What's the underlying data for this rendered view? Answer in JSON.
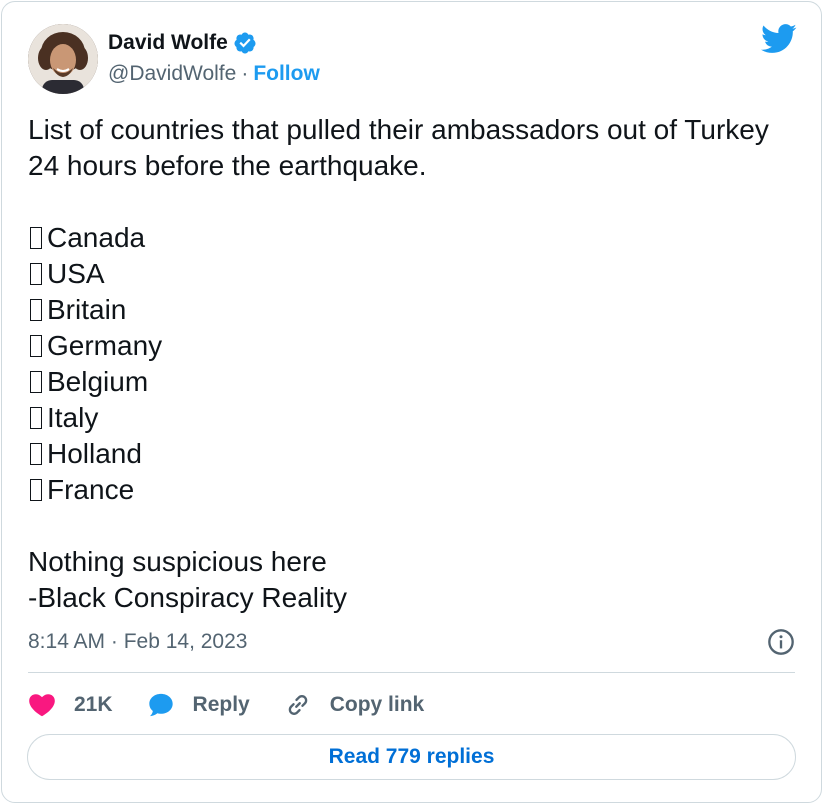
{
  "author": {
    "name": "David Wolfe",
    "handle": "@DavidWolfe",
    "separator": "·",
    "follow_label": "Follow"
  },
  "tweet": {
    "intro": "List of countries that pulled their ambassadors out of Turkey 24 hours before the earthquake.",
    "countries": [
      "Canada",
      "USA",
      "Britain",
      "Germany",
      "Belgium",
      "Italy",
      "Holland",
      "France"
    ],
    "outro_line1": "Nothing suspicious here",
    "outro_line2": "-Black Conspiracy Reality"
  },
  "meta": {
    "timestamp": "8:14 AM · Feb 14, 2023"
  },
  "actions": {
    "likes_count": "21K",
    "reply_label": "Reply",
    "copy_link_label": "Copy link"
  },
  "footer": {
    "read_replies_label": "Read 779 replies"
  },
  "colors": {
    "accent": "#1d9bf0",
    "like": "#f91880",
    "secondary_text": "#536471",
    "border": "#cfd9de"
  },
  "icons": [
    "verified-badge-icon",
    "twitter-bird-icon",
    "info-icon",
    "heart-icon",
    "reply-bubble-icon",
    "link-icon",
    "missing-glyph-box-icon"
  ]
}
